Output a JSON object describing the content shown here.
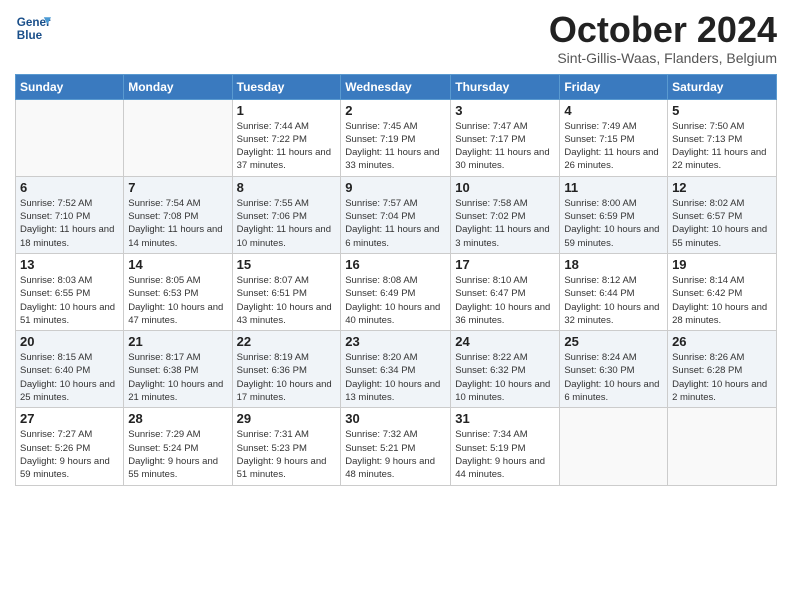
{
  "header": {
    "logo_line1": "General",
    "logo_line2": "Blue",
    "month_title": "October 2024",
    "subtitle": "Sint-Gillis-Waas, Flanders, Belgium"
  },
  "weekdays": [
    "Sunday",
    "Monday",
    "Tuesday",
    "Wednesday",
    "Thursday",
    "Friday",
    "Saturday"
  ],
  "weeks": [
    [
      {
        "day": "",
        "sunrise": "",
        "sunset": "",
        "daylight": ""
      },
      {
        "day": "",
        "sunrise": "",
        "sunset": "",
        "daylight": ""
      },
      {
        "day": "1",
        "sunrise": "Sunrise: 7:44 AM",
        "sunset": "Sunset: 7:22 PM",
        "daylight": "Daylight: 11 hours and 37 minutes."
      },
      {
        "day": "2",
        "sunrise": "Sunrise: 7:45 AM",
        "sunset": "Sunset: 7:19 PM",
        "daylight": "Daylight: 11 hours and 33 minutes."
      },
      {
        "day": "3",
        "sunrise": "Sunrise: 7:47 AM",
        "sunset": "Sunset: 7:17 PM",
        "daylight": "Daylight: 11 hours and 30 minutes."
      },
      {
        "day": "4",
        "sunrise": "Sunrise: 7:49 AM",
        "sunset": "Sunset: 7:15 PM",
        "daylight": "Daylight: 11 hours and 26 minutes."
      },
      {
        "day": "5",
        "sunrise": "Sunrise: 7:50 AM",
        "sunset": "Sunset: 7:13 PM",
        "daylight": "Daylight: 11 hours and 22 minutes."
      }
    ],
    [
      {
        "day": "6",
        "sunrise": "Sunrise: 7:52 AM",
        "sunset": "Sunset: 7:10 PM",
        "daylight": "Daylight: 11 hours and 18 minutes."
      },
      {
        "day": "7",
        "sunrise": "Sunrise: 7:54 AM",
        "sunset": "Sunset: 7:08 PM",
        "daylight": "Daylight: 11 hours and 14 minutes."
      },
      {
        "day": "8",
        "sunrise": "Sunrise: 7:55 AM",
        "sunset": "Sunset: 7:06 PM",
        "daylight": "Daylight: 11 hours and 10 minutes."
      },
      {
        "day": "9",
        "sunrise": "Sunrise: 7:57 AM",
        "sunset": "Sunset: 7:04 PM",
        "daylight": "Daylight: 11 hours and 6 minutes."
      },
      {
        "day": "10",
        "sunrise": "Sunrise: 7:58 AM",
        "sunset": "Sunset: 7:02 PM",
        "daylight": "Daylight: 11 hours and 3 minutes."
      },
      {
        "day": "11",
        "sunrise": "Sunrise: 8:00 AM",
        "sunset": "Sunset: 6:59 PM",
        "daylight": "Daylight: 10 hours and 59 minutes."
      },
      {
        "day": "12",
        "sunrise": "Sunrise: 8:02 AM",
        "sunset": "Sunset: 6:57 PM",
        "daylight": "Daylight: 10 hours and 55 minutes."
      }
    ],
    [
      {
        "day": "13",
        "sunrise": "Sunrise: 8:03 AM",
        "sunset": "Sunset: 6:55 PM",
        "daylight": "Daylight: 10 hours and 51 minutes."
      },
      {
        "day": "14",
        "sunrise": "Sunrise: 8:05 AM",
        "sunset": "Sunset: 6:53 PM",
        "daylight": "Daylight: 10 hours and 47 minutes."
      },
      {
        "day": "15",
        "sunrise": "Sunrise: 8:07 AM",
        "sunset": "Sunset: 6:51 PM",
        "daylight": "Daylight: 10 hours and 43 minutes."
      },
      {
        "day": "16",
        "sunrise": "Sunrise: 8:08 AM",
        "sunset": "Sunset: 6:49 PM",
        "daylight": "Daylight: 10 hours and 40 minutes."
      },
      {
        "day": "17",
        "sunrise": "Sunrise: 8:10 AM",
        "sunset": "Sunset: 6:47 PM",
        "daylight": "Daylight: 10 hours and 36 minutes."
      },
      {
        "day": "18",
        "sunrise": "Sunrise: 8:12 AM",
        "sunset": "Sunset: 6:44 PM",
        "daylight": "Daylight: 10 hours and 32 minutes."
      },
      {
        "day": "19",
        "sunrise": "Sunrise: 8:14 AM",
        "sunset": "Sunset: 6:42 PM",
        "daylight": "Daylight: 10 hours and 28 minutes."
      }
    ],
    [
      {
        "day": "20",
        "sunrise": "Sunrise: 8:15 AM",
        "sunset": "Sunset: 6:40 PM",
        "daylight": "Daylight: 10 hours and 25 minutes."
      },
      {
        "day": "21",
        "sunrise": "Sunrise: 8:17 AM",
        "sunset": "Sunset: 6:38 PM",
        "daylight": "Daylight: 10 hours and 21 minutes."
      },
      {
        "day": "22",
        "sunrise": "Sunrise: 8:19 AM",
        "sunset": "Sunset: 6:36 PM",
        "daylight": "Daylight: 10 hours and 17 minutes."
      },
      {
        "day": "23",
        "sunrise": "Sunrise: 8:20 AM",
        "sunset": "Sunset: 6:34 PM",
        "daylight": "Daylight: 10 hours and 13 minutes."
      },
      {
        "day": "24",
        "sunrise": "Sunrise: 8:22 AM",
        "sunset": "Sunset: 6:32 PM",
        "daylight": "Daylight: 10 hours and 10 minutes."
      },
      {
        "day": "25",
        "sunrise": "Sunrise: 8:24 AM",
        "sunset": "Sunset: 6:30 PM",
        "daylight": "Daylight: 10 hours and 6 minutes."
      },
      {
        "day": "26",
        "sunrise": "Sunrise: 8:26 AM",
        "sunset": "Sunset: 6:28 PM",
        "daylight": "Daylight: 10 hours and 2 minutes."
      }
    ],
    [
      {
        "day": "27",
        "sunrise": "Sunrise: 7:27 AM",
        "sunset": "Sunset: 5:26 PM",
        "daylight": "Daylight: 9 hours and 59 minutes."
      },
      {
        "day": "28",
        "sunrise": "Sunrise: 7:29 AM",
        "sunset": "Sunset: 5:24 PM",
        "daylight": "Daylight: 9 hours and 55 minutes."
      },
      {
        "day": "29",
        "sunrise": "Sunrise: 7:31 AM",
        "sunset": "Sunset: 5:23 PM",
        "daylight": "Daylight: 9 hours and 51 minutes."
      },
      {
        "day": "30",
        "sunrise": "Sunrise: 7:32 AM",
        "sunset": "Sunset: 5:21 PM",
        "daylight": "Daylight: 9 hours and 48 minutes."
      },
      {
        "day": "31",
        "sunrise": "Sunrise: 7:34 AM",
        "sunset": "Sunset: 5:19 PM",
        "daylight": "Daylight: 9 hours and 44 minutes."
      },
      {
        "day": "",
        "sunrise": "",
        "sunset": "",
        "daylight": ""
      },
      {
        "day": "",
        "sunrise": "",
        "sunset": "",
        "daylight": ""
      }
    ]
  ]
}
